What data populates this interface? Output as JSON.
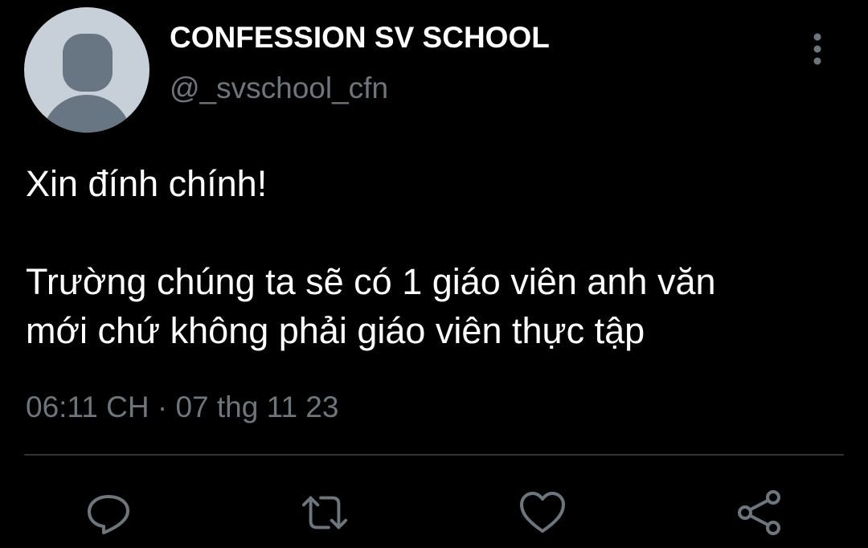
{
  "author": {
    "display_name": "CONFESSION SV SCHOOL",
    "handle": "@_svschool_cfn",
    "avatar_icon": "default-avatar-icon"
  },
  "tweet": {
    "paragraphs": [
      "Xin đính chính!",
      "Trường chúng ta sẽ có 1 giáo viên anh văn\nmới chứ không phải giáo viên thực tập"
    ],
    "time": "06:11 CH",
    "separator": "·",
    "date": "07 thg 11 23"
  },
  "actions": [
    {
      "name": "reply",
      "icon": "reply-icon"
    },
    {
      "name": "retweet",
      "icon": "retweet-icon"
    },
    {
      "name": "like",
      "icon": "heart-icon"
    },
    {
      "name": "share",
      "icon": "share-icon"
    }
  ],
  "colors": {
    "background": "#000000",
    "text": "#ffffff",
    "secondary": "#6e767d",
    "avatar_bg": "#c7d0d8",
    "avatar_figure": "#687684",
    "divider": "#2f3336"
  }
}
